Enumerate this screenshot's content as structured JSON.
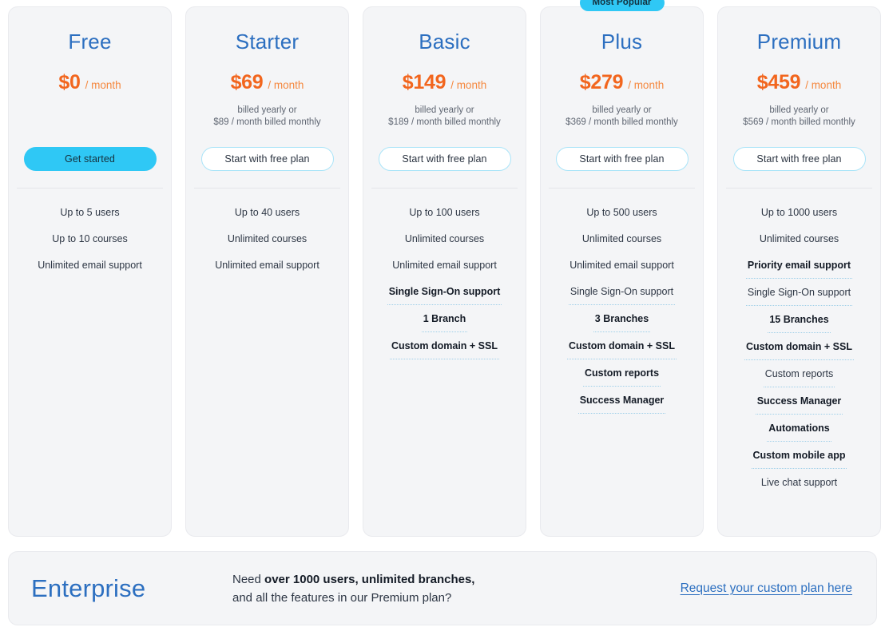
{
  "badge_label": "Most Popular",
  "colors": {
    "accent_cyan": "#2fc8f5",
    "title_blue": "#2c6fc0",
    "price_orange": "#f2661e",
    "per_month_orange": "#f5883f",
    "card_bg": "#f4f5f7",
    "text_dark": "#2d3644"
  },
  "plans": [
    {
      "name": "Free",
      "price": "$0",
      "per": "/ month",
      "billing": "",
      "cta": "Get started",
      "cta_style": "solid",
      "popular": false,
      "features": [
        {
          "label": "Up to 5 users",
          "bold": false,
          "dotted": false
        },
        {
          "label": "Up to 10 courses",
          "bold": false,
          "dotted": false
        },
        {
          "label": "Unlimited email support",
          "bold": false,
          "dotted": false
        }
      ]
    },
    {
      "name": "Starter",
      "price": "$69",
      "per": "/ month",
      "billing": "billed yearly or\n$89 / month billed monthly",
      "cta": "Start with free plan",
      "cta_style": "outline",
      "popular": false,
      "features": [
        {
          "label": "Up to 40 users",
          "bold": false,
          "dotted": false
        },
        {
          "label": "Unlimited courses",
          "bold": false,
          "dotted": false
        },
        {
          "label": "Unlimited email support",
          "bold": false,
          "dotted": false
        }
      ]
    },
    {
      "name": "Basic",
      "price": "$149",
      "per": "/ month",
      "billing": "billed yearly or\n$189 / month billed monthly",
      "cta": "Start with free plan",
      "cta_style": "outline",
      "popular": false,
      "features": [
        {
          "label": "Up to 100 users",
          "bold": false,
          "dotted": false
        },
        {
          "label": "Unlimited courses",
          "bold": false,
          "dotted": false
        },
        {
          "label": "Unlimited email support",
          "bold": false,
          "dotted": false
        },
        {
          "label": "Single Sign-On support",
          "bold": true,
          "dotted": true
        },
        {
          "label": "1 Branch",
          "bold": true,
          "dotted": true
        },
        {
          "label": "Custom domain + SSL",
          "bold": true,
          "dotted": true
        }
      ]
    },
    {
      "name": "Plus",
      "price": "$279",
      "per": "/ month",
      "billing": "billed yearly or\n$369 / month billed monthly",
      "cta": "Start with free plan",
      "cta_style": "outline",
      "popular": true,
      "features": [
        {
          "label": "Up to 500 users",
          "bold": false,
          "dotted": false
        },
        {
          "label": "Unlimited courses",
          "bold": false,
          "dotted": false
        },
        {
          "label": "Unlimited email support",
          "bold": false,
          "dotted": false
        },
        {
          "label": "Single Sign-On support",
          "bold": false,
          "dotted": true
        },
        {
          "label": "3 Branches",
          "bold": true,
          "dotted": true
        },
        {
          "label": "Custom domain + SSL",
          "bold": true,
          "dotted": true
        },
        {
          "label": "Custom reports",
          "bold": true,
          "dotted": true
        },
        {
          "label": "Success Manager",
          "bold": true,
          "dotted": true
        }
      ]
    },
    {
      "name": "Premium",
      "price": "$459",
      "per": "/ month",
      "billing": "billed yearly or\n$569 / month billed monthly",
      "cta": "Start with free plan",
      "cta_style": "outline",
      "popular": false,
      "features": [
        {
          "label": "Up to 1000 users",
          "bold": false,
          "dotted": false
        },
        {
          "label": "Unlimited courses",
          "bold": false,
          "dotted": false
        },
        {
          "label": "Priority email support",
          "bold": true,
          "dotted": true
        },
        {
          "label": "Single Sign-On support",
          "bold": false,
          "dotted": true
        },
        {
          "label": "15 Branches",
          "bold": true,
          "dotted": true
        },
        {
          "label": "Custom domain + SSL",
          "bold": true,
          "dotted": true
        },
        {
          "label": "Custom reports",
          "bold": false,
          "dotted": true
        },
        {
          "label": "Success Manager",
          "bold": true,
          "dotted": true
        },
        {
          "label": "Automations",
          "bold": true,
          "dotted": true
        },
        {
          "label": "Custom mobile app",
          "bold": true,
          "dotted": true
        },
        {
          "label": "Live chat support",
          "bold": false,
          "dotted": false
        }
      ]
    }
  ],
  "enterprise": {
    "title": "Enterprise",
    "copy_prefix": "Need ",
    "copy_bold": "over 1000 users, unlimited branches,",
    "copy_line2": "and all the features in our Premium plan?",
    "link": "Request your custom plan here"
  }
}
